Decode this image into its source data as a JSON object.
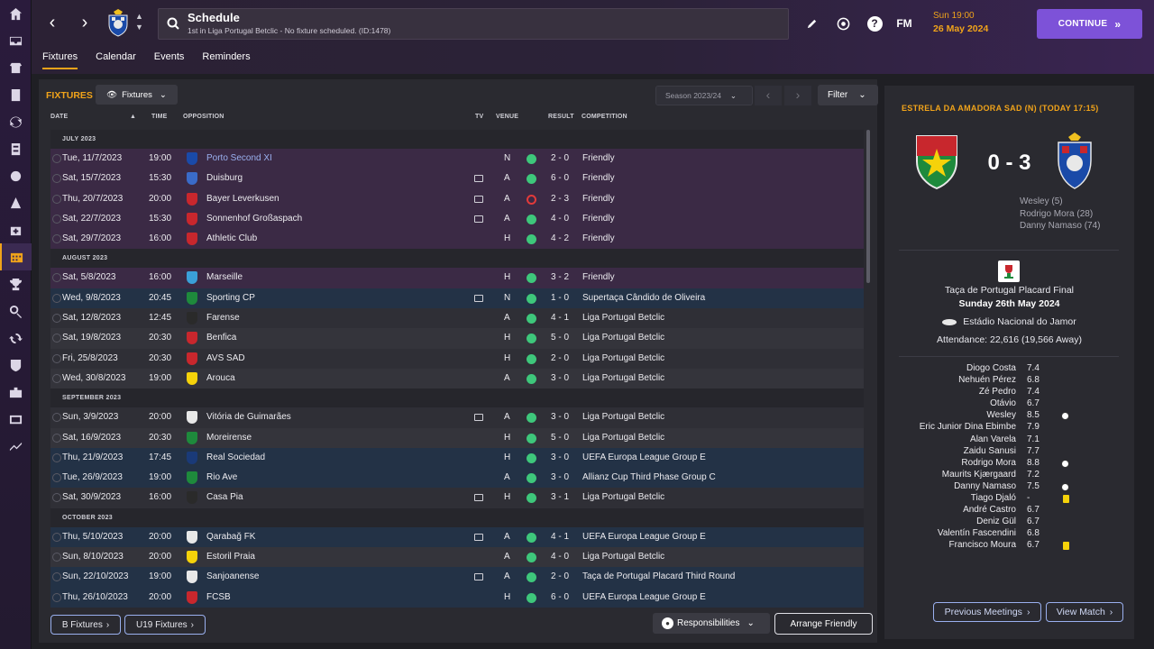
{
  "header": {
    "title": "Schedule",
    "subtitle": "1st in Liga Portugal Betclic - No fixture scheduled. (ID:1478)",
    "fm_label": "FM",
    "date_time": "Sun 19:00",
    "date": "26 May 2024",
    "continue_label": "CONTINUE",
    "tabs": [
      "Fixtures",
      "Calendar",
      "Events",
      "Reminders"
    ]
  },
  "toolbar": {
    "section_title": "FIXTURES",
    "view_label": "Fixtures",
    "season_label": "Season 2023/24",
    "filter_label": "Filter"
  },
  "columns": {
    "date": "DATE",
    "time": "TIME",
    "opposition": "OPPOSITION",
    "tv": "TV",
    "venue": "VENUE",
    "result": "RESULT",
    "competition": "COMPETITION"
  },
  "months": {
    "july": "JULY 2023",
    "august": "AUGUST 2023",
    "september": "SEPTEMBER 2023",
    "october": "OCTOBER 2023"
  },
  "fixtures": [
    {
      "date": "Tue, 11/7/2023",
      "time": "19:00",
      "opp": "Porto Second XI",
      "venue": "N",
      "result": "2 - 0",
      "comp": "Friendly"
    },
    {
      "date": "Sat, 15/7/2023",
      "time": "15:30",
      "opp": "Duisburg",
      "venue": "A",
      "result": "6 - 0",
      "comp": "Friendly"
    },
    {
      "date": "Thu, 20/7/2023",
      "time": "20:00",
      "opp": "Bayer Leverkusen",
      "venue": "A",
      "result": "2 - 3",
      "comp": "Friendly"
    },
    {
      "date": "Sat, 22/7/2023",
      "time": "15:30",
      "opp": "Sonnenhof Großaspach",
      "venue": "A",
      "result": "4 - 0",
      "comp": "Friendly"
    },
    {
      "date": "Sat, 29/7/2023",
      "time": "16:00",
      "opp": "Athletic Club",
      "venue": "H",
      "result": "4 - 2",
      "comp": "Friendly"
    },
    {
      "date": "Sat, 5/8/2023",
      "time": "16:00",
      "opp": "Marseille",
      "venue": "H",
      "result": "3 - 2",
      "comp": "Friendly"
    },
    {
      "date": "Wed, 9/8/2023",
      "time": "20:45",
      "opp": "Sporting CP",
      "venue": "N",
      "result": "1 - 0",
      "comp": "Supertaça Cândido de Oliveira"
    },
    {
      "date": "Sat, 12/8/2023",
      "time": "12:45",
      "opp": "Farense",
      "venue": "A",
      "result": "4 - 1",
      "comp": "Liga Portugal Betclic"
    },
    {
      "date": "Sat, 19/8/2023",
      "time": "20:30",
      "opp": "Benfica",
      "venue": "H",
      "result": "5 - 0",
      "comp": "Liga Portugal Betclic"
    },
    {
      "date": "Fri, 25/8/2023",
      "time": "20:30",
      "opp": "AVS SAD",
      "venue": "H",
      "result": "2 - 0",
      "comp": "Liga Portugal Betclic"
    },
    {
      "date": "Wed, 30/8/2023",
      "time": "19:00",
      "opp": "Arouca",
      "venue": "A",
      "result": "3 - 0",
      "comp": "Liga Portugal Betclic"
    },
    {
      "date": "Sun, 3/9/2023",
      "time": "20:00",
      "opp": "Vitória de Guimarães",
      "venue": "A",
      "result": "3 - 0",
      "comp": "Liga Portugal Betclic"
    },
    {
      "date": "Sat, 16/9/2023",
      "time": "20:30",
      "opp": "Moreirense",
      "venue": "H",
      "result": "5 - 0",
      "comp": "Liga Portugal Betclic"
    },
    {
      "date": "Thu, 21/9/2023",
      "time": "17:45",
      "opp": "Real Sociedad",
      "venue": "H",
      "result": "3 - 0",
      "comp": "UEFA Europa League Group E"
    },
    {
      "date": "Tue, 26/9/2023",
      "time": "19:00",
      "opp": "Rio Ave",
      "venue": "A",
      "result": "3 - 0",
      "comp": "Allianz Cup Third Phase Group C"
    },
    {
      "date": "Sat, 30/9/2023",
      "time": "16:00",
      "opp": "Casa Pia",
      "venue": "H",
      "result": "3 - 1",
      "comp": "Liga Portugal Betclic"
    },
    {
      "date": "Thu, 5/10/2023",
      "time": "20:00",
      "opp": "Qarabağ FK",
      "venue": "A",
      "result": "4 - 1",
      "comp": "UEFA Europa League Group E"
    },
    {
      "date": "Sun, 8/10/2023",
      "time": "20:00",
      "opp": "Estoril Praia",
      "venue": "A",
      "result": "4 - 0",
      "comp": "Liga Portugal Betclic"
    },
    {
      "date": "Sun, 22/10/2023",
      "time": "19:00",
      "opp": "Sanjoanense",
      "venue": "A",
      "result": "2 - 0",
      "comp": "Taça de Portugal Placard Third Round"
    },
    {
      "date": "Thu, 26/10/2023",
      "time": "20:00",
      "opp": "FCSB",
      "venue": "H",
      "result": "6 - 0",
      "comp": "UEFA Europa League Group E"
    }
  ],
  "bottom": {
    "b_fixtures": "B Fixtures",
    "u19_fixtures": "U19 Fixtures",
    "responsibilities": "Responsibilities",
    "arrange_friendly": "Arrange Friendly"
  },
  "match": {
    "heading": "ESTRELA DA AMADORA SAD (N) (TODAY 17:15)",
    "score": "0 - 3",
    "scorers": [
      "Wesley (5)",
      "Rodrigo Mora (28)",
      "Danny Namaso (74)"
    ],
    "competition": "Taça de Portugal Placard Final",
    "date": "Sunday 26th May 2024",
    "stadium": "Estádio Nacional do Jamor",
    "attendance": "Attendance: 22,616 (19,566 Away)",
    "ratings": [
      {
        "name": "Diogo Costa",
        "rating": "7.4"
      },
      {
        "name": "Nehuén Pérez",
        "rating": "6.8"
      },
      {
        "name": "Zé Pedro",
        "rating": "7.4"
      },
      {
        "name": "Otávio",
        "rating": "6.7"
      },
      {
        "name": "Wesley",
        "rating": "8.5"
      },
      {
        "name": "Eric Junior Dina Ebimbe",
        "rating": "7.9"
      },
      {
        "name": "Alan Varela",
        "rating": "7.1"
      },
      {
        "name": "Zaidu Sanusi",
        "rating": "7.7"
      },
      {
        "name": "Rodrigo Mora",
        "rating": "8.8"
      },
      {
        "name": "Maurits Kjærgaard",
        "rating": "7.2"
      },
      {
        "name": "Danny Namaso",
        "rating": "7.5"
      },
      {
        "name": "Tiago Djaló",
        "rating": "-"
      },
      {
        "name": "André Castro",
        "rating": "6.7"
      },
      {
        "name": "Deniz Gül",
        "rating": "6.7"
      },
      {
        "name": "Valentín Fascendini",
        "rating": "6.8"
      },
      {
        "name": "Francisco Moura",
        "rating": "6.7"
      }
    ],
    "previous_meetings": "Previous Meetings",
    "view_match": "View Match"
  },
  "colors": {
    "accent": "#f0a31a",
    "continue": "#7d52d8",
    "win": "#3ec77b",
    "loss": "#e23a3a",
    "link": "#9ab0ef"
  }
}
